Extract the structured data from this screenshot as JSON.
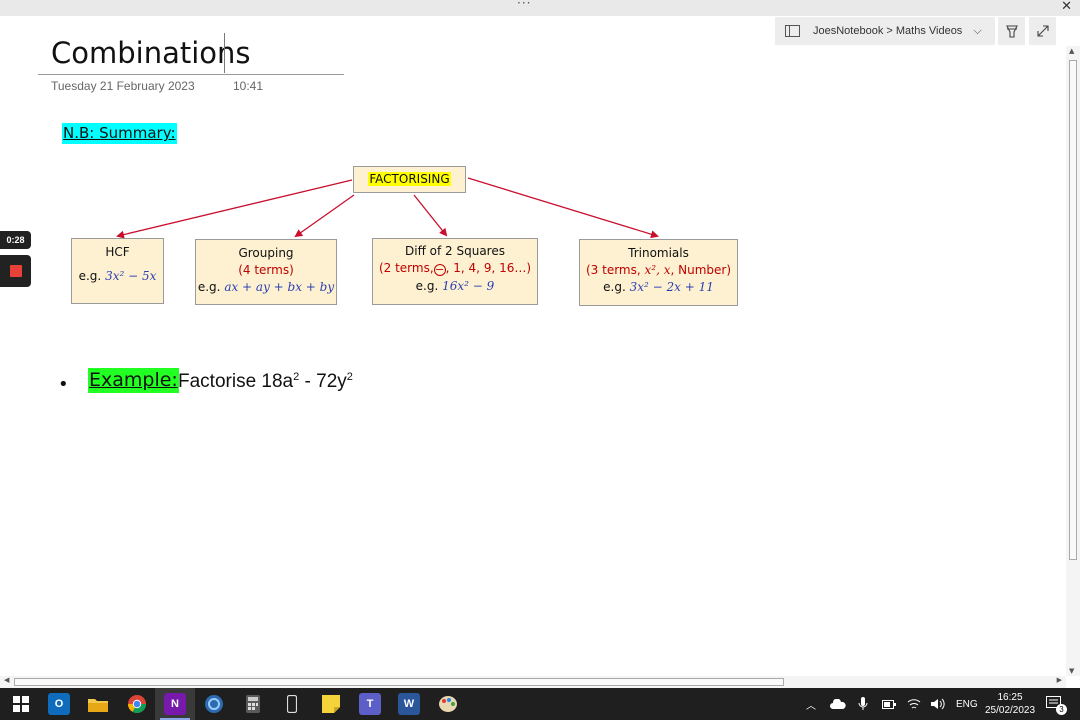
{
  "window": {
    "dots": "···",
    "close_glyph": "✕"
  },
  "notebook": {
    "breadcrumb": "JoesNotebook > Maths Videos"
  },
  "page": {
    "title": "Combinations",
    "date": "Tuesday 21 February 2023",
    "time": "10:41",
    "summary_label": "N.B: Summary:"
  },
  "diagram": {
    "main": "FACTORISING",
    "hcf": {
      "title": "HCF",
      "example_prefix": "e.g.",
      "example": "3x² − 5x"
    },
    "grouping": {
      "title": "Grouping",
      "note": "(4 terms)",
      "example_prefix": "e.g.",
      "example": "ax + ay + bx + by"
    },
    "diff": {
      "title": "Diff of 2 Squares",
      "note_a": "(2 terms,",
      "note_b": ", 1, 4, 9, 16…)",
      "minus": "−",
      "example_prefix": "e.g.",
      "example": "16x² − 9"
    },
    "trinomials": {
      "title": "Trinomials",
      "note_a": "(3 terms, ",
      "note_math": "x², x",
      "note_b": ", Number)",
      "example_prefix": "e.g.",
      "example": "3x² − 2x + 11"
    }
  },
  "example": {
    "label": "Example:",
    "text_a": "Factorise  18a",
    "sup_a": "2",
    "text_b": " - 72y",
    "sup_b": "2"
  },
  "recorder": {
    "elapsed": "0:28"
  },
  "taskbar": {
    "language": "ENG",
    "clock_time": "16:25",
    "clock_date": "25/02/2023",
    "notifications": "3"
  }
}
